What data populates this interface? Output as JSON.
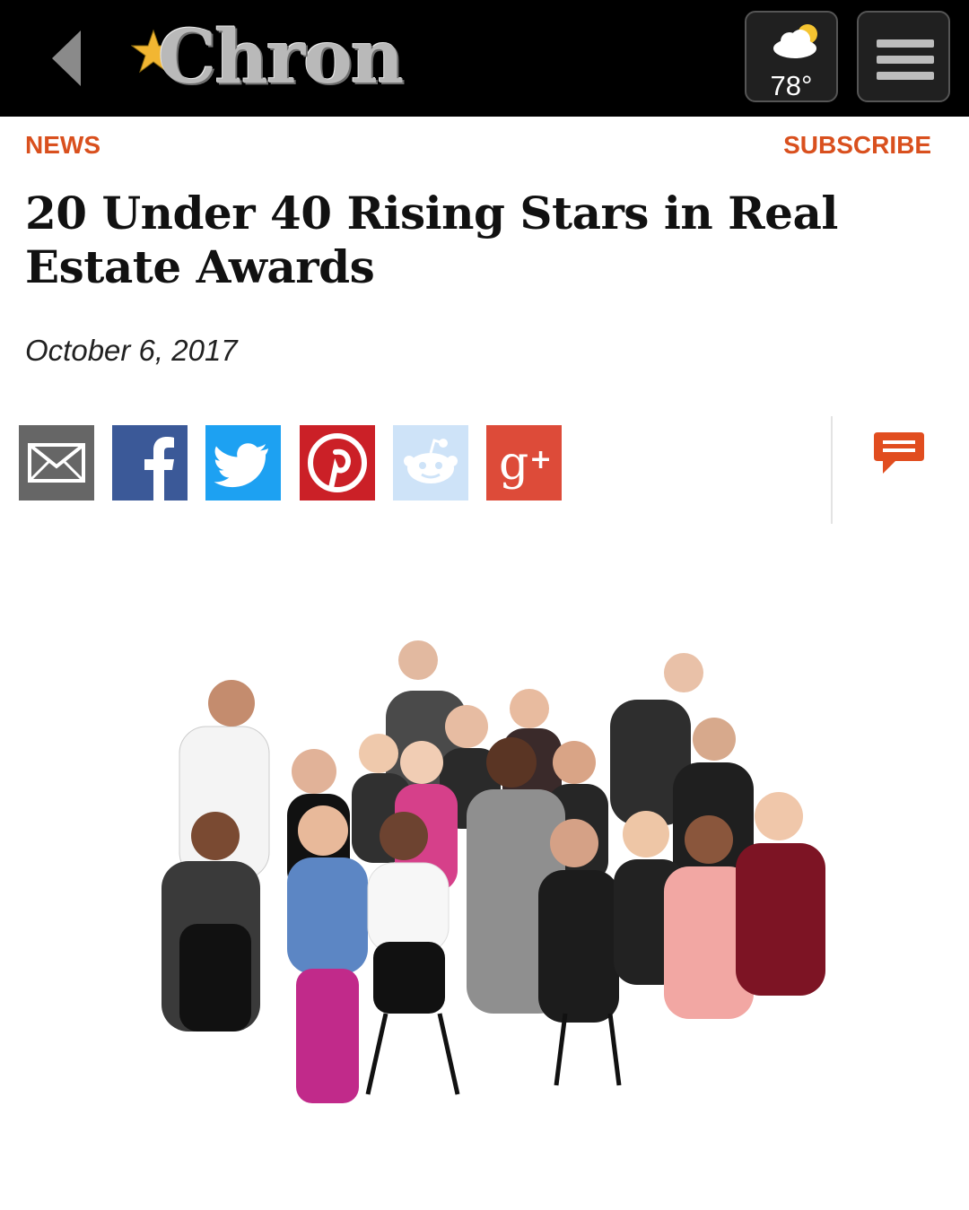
{
  "header": {
    "logo_text": "Chron",
    "weather_temp": "78°",
    "icons": [
      "back-arrow-icon",
      "star-icon",
      "partly-cloudy-icon",
      "hamburger-menu-icon"
    ]
  },
  "nav": {
    "section_label": "NEWS",
    "subscribe_label": "SUBSCRIBE"
  },
  "article": {
    "headline": "20 Under 40 Rising Stars in Real Estate Awards",
    "date": "October 6, 2017"
  },
  "share": {
    "buttons": [
      {
        "name": "email",
        "icon": "envelope-icon",
        "color": "#666666"
      },
      {
        "name": "facebook",
        "icon": "facebook-icon",
        "color": "#3b5998"
      },
      {
        "name": "twitter",
        "icon": "twitter-bird-icon",
        "color": "#1da1f2"
      },
      {
        "name": "pinterest",
        "icon": "pinterest-icon",
        "color": "#cb2027"
      },
      {
        "name": "reddit",
        "icon": "reddit-alien-icon",
        "color": "#cee3f8"
      },
      {
        "name": "google-plus",
        "icon": "google-plus-icon",
        "color": "#dd4b39"
      }
    ],
    "comment_icon": "comment-bubble-icon"
  },
  "colors": {
    "accent": "#d9501e",
    "topbar": "#000000"
  }
}
